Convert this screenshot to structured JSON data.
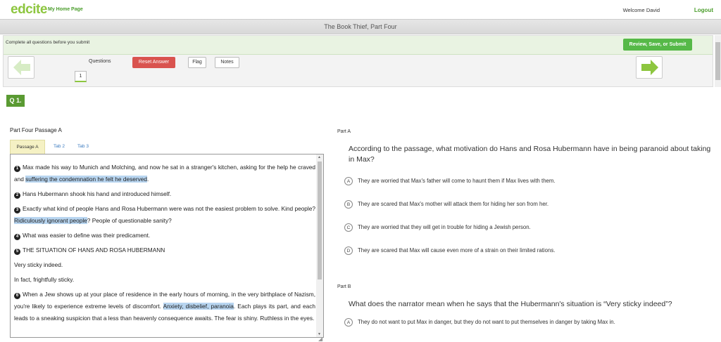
{
  "app": {
    "logo": "edcite",
    "home_link": "My Home Page",
    "welcome": "Welcome David",
    "logout": "Logout"
  },
  "assignment": {
    "title": "The Book Thief, Part Four"
  },
  "nav": {
    "complete_message": "Complete all questions before you submit",
    "review_button": "Review, Save, or Submit",
    "questions_label": "Questions",
    "question_numbers": [
      "1"
    ],
    "reset_button": "Reset Answer",
    "flag_button": "Flag",
    "notes_button": "Notes",
    "prev_icon": "arrow-left-icon",
    "next_icon": "arrow-right-icon"
  },
  "question": {
    "badge": "Q 1."
  },
  "passage": {
    "title": "Part Four Passage A",
    "tabs": [
      "Passage A",
      "Tab 2",
      "Tab 3"
    ],
    "paragraphs": [
      {
        "num": "1",
        "before": "Max made his way to Munich and Molching, and now he sat in a stranger's kitchen, asking for the help he craved and ",
        "highlight": "suffering the condemnation he felt he deserved",
        "after": "."
      },
      {
        "num": "2",
        "before": "Hans Hubermann shook his hand and introduced himself.",
        "highlight": "",
        "after": ""
      },
      {
        "num": "3",
        "before": "Exactly what kind of people Hans and Rosa Hubermann were was not the easiest problem to solve. Kind people? ",
        "highlight": "Ridiculously ignorant people",
        "after": "? People of questionable sanity?"
      },
      {
        "num": "4",
        "before": "What was easier to define was their predicament.",
        "highlight": "",
        "after": ""
      },
      {
        "num": "5",
        "before": "THE SITUATION OF HANS AND ROSA HUBERMANN",
        "highlight": "",
        "after": ""
      },
      {
        "num": "",
        "before": "Very sticky indeed.",
        "highlight": "",
        "after": ""
      },
      {
        "num": "",
        "before": "In fact, frightfully sticky.",
        "highlight": "",
        "after": ""
      },
      {
        "num": "6",
        "before": "When a Jew shows up at your place of residence in the early hours of morning, in the very birthplace of Nazism, you're likely to experience extreme levels of discomfort. ",
        "highlight": "Anxiety, disbelief, paranoia",
        "after": ". Each plays its part, and each leads to a sneaking suspicion that a less than heavenly consequence awaits. The fear is shiny. Ruthless in the eyes."
      }
    ]
  },
  "part_a": {
    "label": "Part A",
    "stem": "According to the passage, what motivation do Hans and Rosa Hubermann have in being paranoid about taking in Max?",
    "options": [
      {
        "letter": "A",
        "text": "They are worried that Max's father will come to haunt them if Max lives with them."
      },
      {
        "letter": "B",
        "text": "They are scared that Max's mother will attack them for hiding her son from her."
      },
      {
        "letter": "C",
        "text": "They are worried that they will get in trouble for hiding a Jewish person."
      },
      {
        "letter": "D",
        "text": "They are scared that Max will cause even more of a strain on their limited rations."
      }
    ]
  },
  "part_b": {
    "label": "Part B",
    "stem": "What does the narrator mean when he says that the Hubermann's situation is “Very sticky indeed”?",
    "options": [
      {
        "letter": "A",
        "text": "They do not want to put Max in danger, but they do not want to put themselves in danger by taking Max in."
      }
    ]
  }
}
